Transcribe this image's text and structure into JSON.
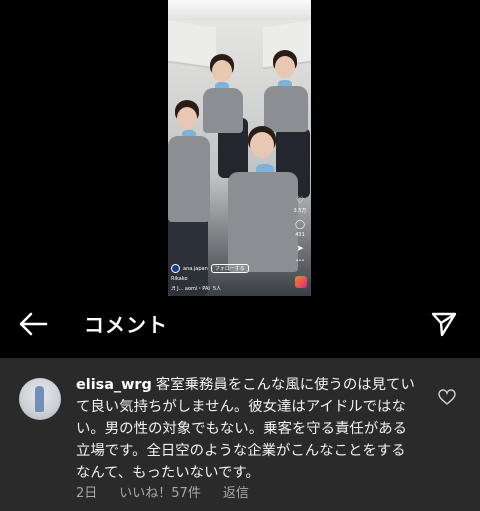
{
  "video": {
    "side_counts": [
      "3.5万",
      "431"
    ],
    "account": "ana.japan",
    "follow_label": "フォローする",
    "caption": "Rikako",
    "audio": "♬ J... aomi・PAI",
    "sound_count": "5人"
  },
  "header": {
    "back_icon": "back-arrow-icon",
    "title": "コメント",
    "send_icon": "paper-plane-icon"
  },
  "comment": {
    "username": "elisa_wrg",
    "text": "客室乗務員をこんな風に使うのは見ていて良い気持ちがしません。彼女達はアイドルではない。男の性の対象でもない。乗客を守る責任がある立場です。全日空のような企業がこんなことをするなんて、もったいないです。",
    "time": "2日",
    "likes": "いいね！57件",
    "reply": "返信",
    "like_icon": "heart-icon"
  },
  "colors": {
    "background": "#000000",
    "comment_bg": "#2a2a2a",
    "meta_text": "#a8a8a8"
  }
}
